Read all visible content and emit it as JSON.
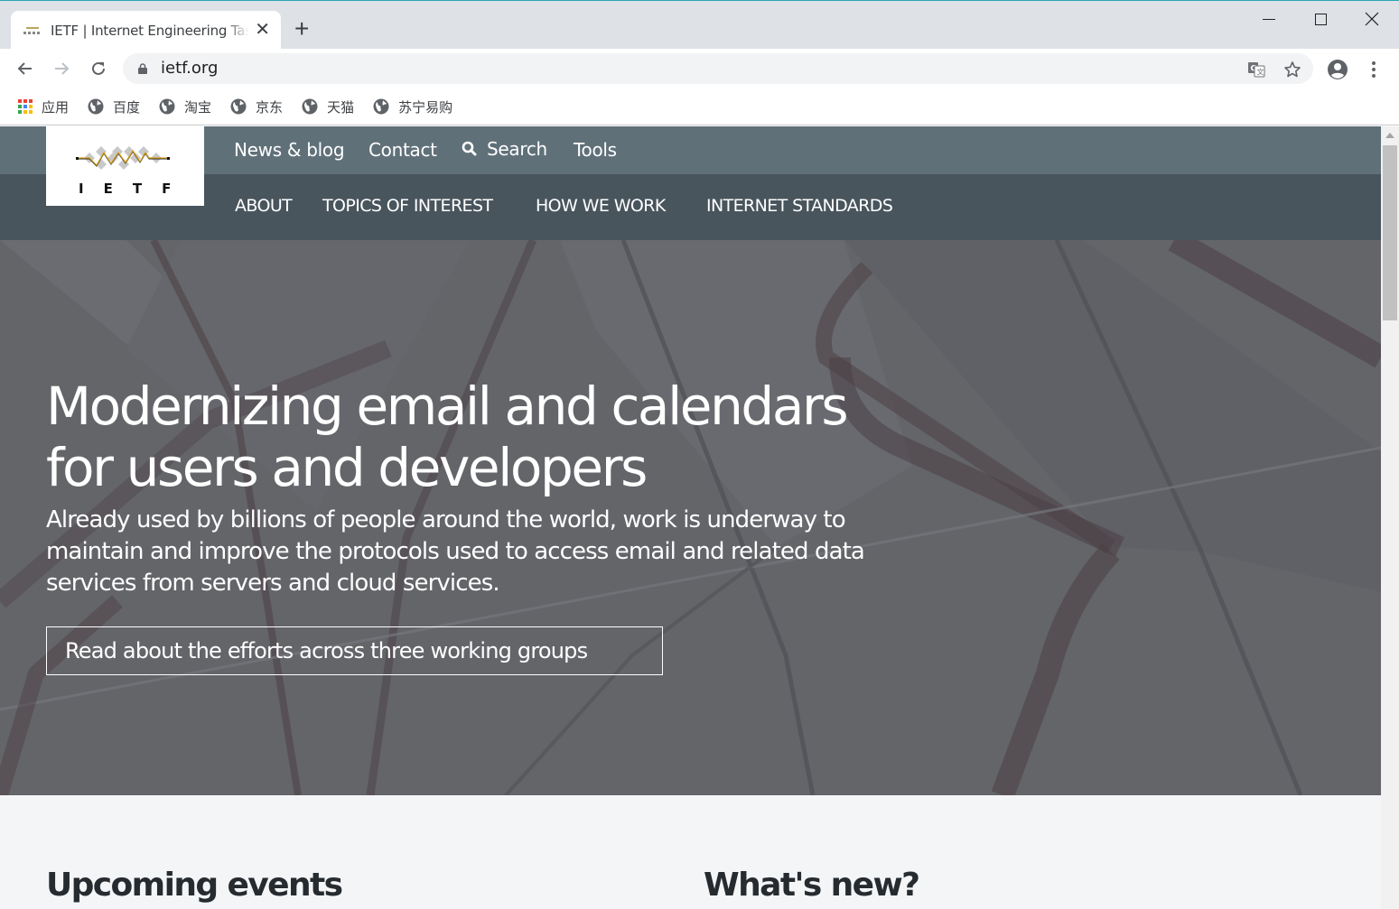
{
  "browser": {
    "tab": {
      "title": "IETF | Internet Engineering Task Force"
    },
    "address_bar": {
      "url": "ietf.org"
    },
    "bookmarks": [
      {
        "label": "应用",
        "icon": "apps-grid-icon"
      },
      {
        "label": "百度",
        "icon": "globe-icon"
      },
      {
        "label": "淘宝",
        "icon": "globe-icon"
      },
      {
        "label": "京东",
        "icon": "globe-icon"
      },
      {
        "label": "天猫",
        "icon": "globe-icon"
      },
      {
        "label": "苏宁易购",
        "icon": "globe-icon"
      }
    ]
  },
  "site": {
    "logo_letters": [
      "I",
      "E",
      "T",
      "F"
    ],
    "utility_nav": [
      {
        "label": "News & blog"
      },
      {
        "label": "Contact"
      },
      {
        "label": "Search",
        "icon": "search-icon"
      },
      {
        "label": "Tools"
      }
    ],
    "main_nav": [
      {
        "label": "ABOUT"
      },
      {
        "label": "TOPICS OF INTEREST"
      },
      {
        "label": "HOW WE WORK"
      },
      {
        "label": "INTERNET STANDARDS"
      }
    ],
    "hero": {
      "title": "Modernizing email and calendars for users and developers",
      "subtitle": "Already used by billions of people around the world, work is underway to maintain and improve the protocols used to access email and related data services from servers and cloud services.",
      "cta_label": "Read about the efforts across three working groups"
    },
    "sections": [
      {
        "heading": "Upcoming events"
      },
      {
        "heading": "What's new?"
      }
    ]
  },
  "colors": {
    "utility_bar": "#607079",
    "main_bar": "#49555d",
    "hero_overlay": "#64666b",
    "logo_accent": "#d4a017"
  }
}
